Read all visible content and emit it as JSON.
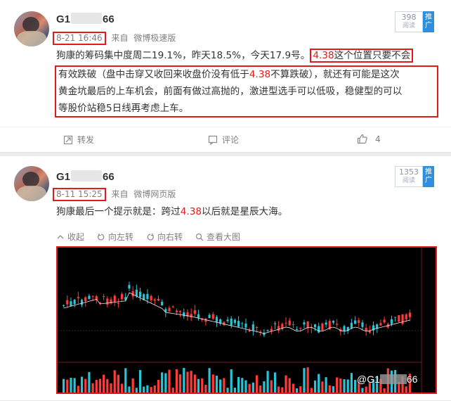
{
  "post1": {
    "name_prefix": "G1",
    "name_suffix": "66",
    "time": "8-21 16:46",
    "from_label": "来自",
    "source": "微博极速版",
    "read_count": "398",
    "read_label": "阅读",
    "push_label": "推广",
    "text_a": "狗康的筹码集中度周二19.1%，昨天18.5%，今天17.9号。",
    "text_hl_price": "4.38",
    "text_hl_rest": "这个位置只要不会",
    "box_line1_a": "有效跌破（盘中击穿又收回来收盘价没有低于",
    "box_line1_price": "4.38",
    "box_line1_b": "不算跌破），就还有可能是这次",
    "box_line2": "黄金坑最后的上车机会，前面有做过高抛的，激进型选手可以低吸，稳健型的可以",
    "box_line3": "等股价站稳5日线再考虑上车。",
    "repost_label": "转发",
    "comment_label": "评论",
    "like_count": "4"
  },
  "post2": {
    "name_prefix": "G1",
    "name_suffix": "66",
    "time": "8-11 15:25",
    "from_label": "来自",
    "source": "微博网页版",
    "read_count": "1353",
    "read_label": "阅读",
    "push_label": "推广",
    "text_a": "狗康最后一个提示就是：跨过",
    "text_price": "4.38",
    "text_b": "以后就是星辰大海。",
    "collapse_label": "收起",
    "rotate_label": "向左转",
    "rotate_right_label": "向右转",
    "view_large_label": "查看大图",
    "watermark_prefix": "@G1",
    "watermark_suffix": "66"
  },
  "colors": {
    "highlight_red": "#e11b1b",
    "push_blue": "#2f8fdf",
    "chart_bg": "#000000",
    "candle_up": "#ff3b3b",
    "candle_down": "#27c6d6"
  }
}
